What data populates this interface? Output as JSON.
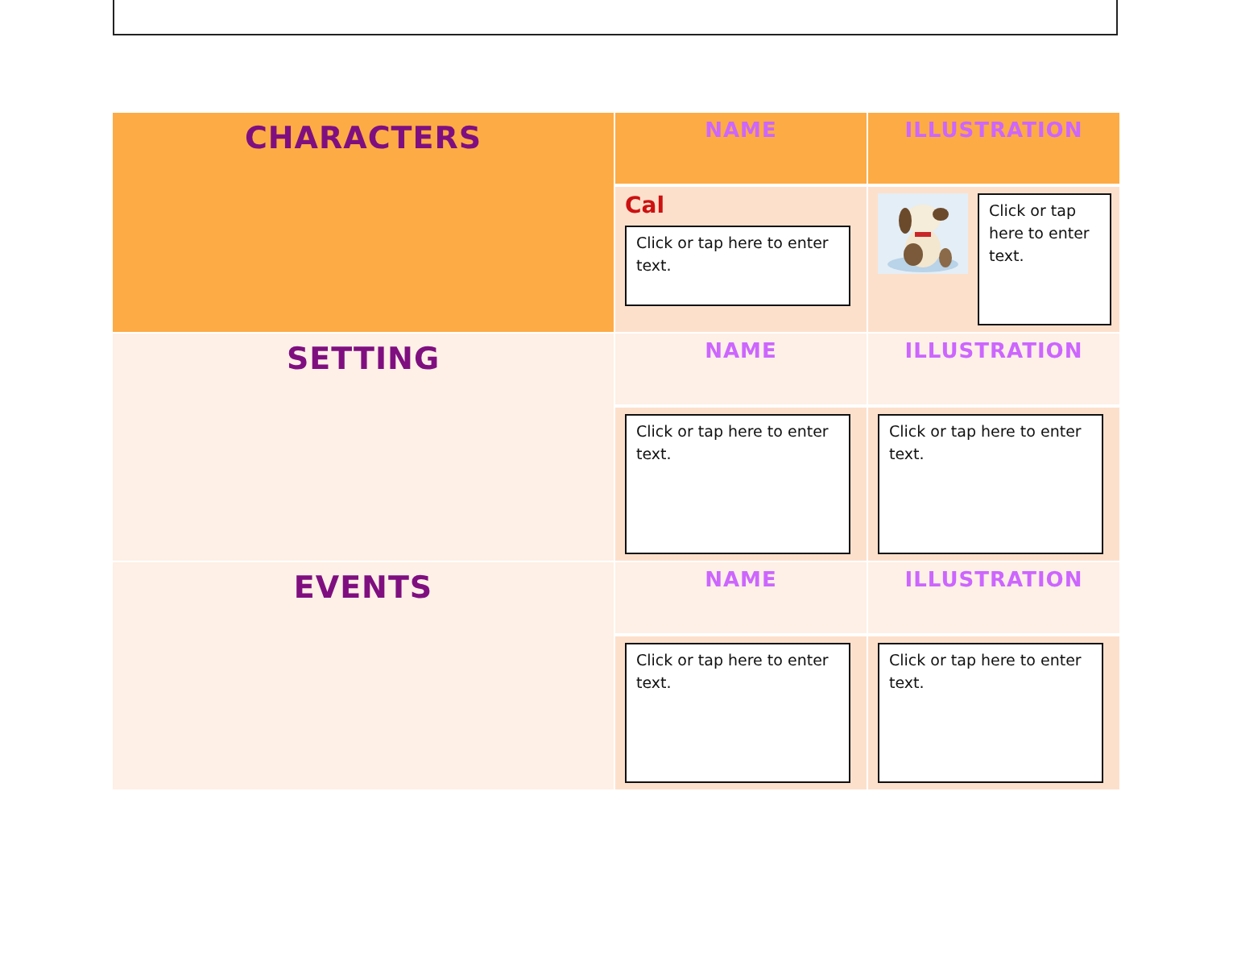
{
  "sections": [
    {
      "title": "CHARACTERS",
      "kind": "highlight",
      "name_header": "NAME",
      "illustration_header": "ILLUSTRATION",
      "name": "Cal",
      "name_field": {
        "placeholder": "Click or tap here to enter text."
      },
      "illustration_field": {
        "placeholder": "Click or tap here to enter text."
      }
    },
    {
      "title": "SETTING",
      "kind": "plain",
      "name_header": "NAME",
      "illustration_header": "ILLUSTRATION",
      "name_field": {
        "placeholder": "Click or tap here to enter text."
      },
      "illustration_field": {
        "placeholder": "Click or tap here to enter text."
      }
    },
    {
      "title": "EVENTS",
      "kind": "plain",
      "name_header": "NAME",
      "illustration_header": "ILLUSTRATION",
      "name_field": {
        "placeholder": "Click or tap here to enter text."
      },
      "illustration_field": {
        "placeholder": "Click or tap here to enter text."
      }
    }
  ]
}
